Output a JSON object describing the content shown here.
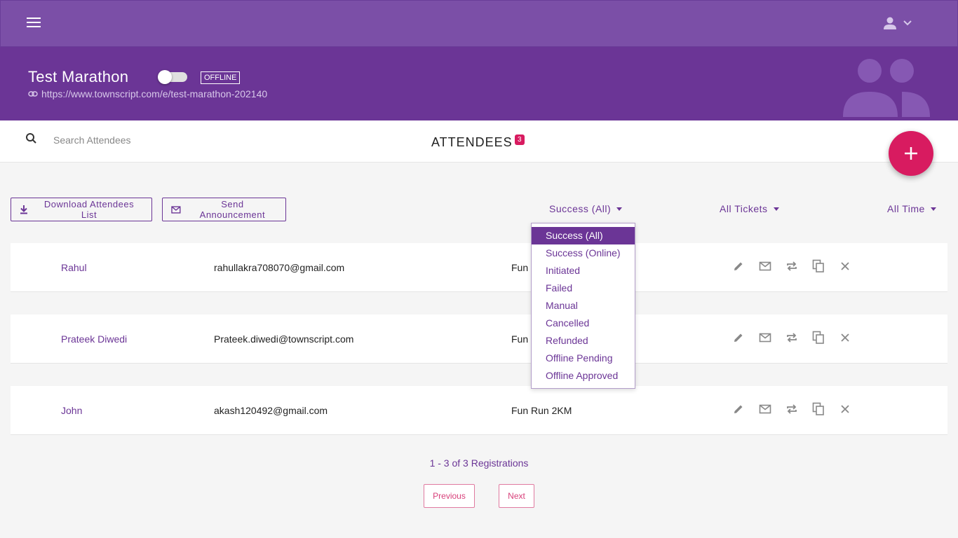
{
  "event": {
    "title": "Test Marathon",
    "status_badge": "OFFLINE",
    "url": "https://www.townscript.com/e/test-marathon-202140"
  },
  "search": {
    "placeholder": "Search Attendees"
  },
  "section": {
    "title": "ATTENDEES",
    "count": "3"
  },
  "actions": {
    "download_label": "Download Attendees List",
    "announce_label": "Send Announcement"
  },
  "filters": {
    "status": "Success (All)",
    "tickets": "All Tickets",
    "time": "All Time",
    "status_options": [
      "Success (All)",
      "Success (Online)",
      "Initiated",
      "Failed",
      "Manual",
      "Cancelled",
      "Refunded",
      "Offline Pending",
      "Offline Approved"
    ]
  },
  "attendees": [
    {
      "name": "Rahul",
      "email": "rahullakra708070@gmail.com",
      "ticket": "Fun"
    },
    {
      "name": "Prateek Diwedi",
      "email": "Prateek.diwedi@townscript.com",
      "ticket": "Fun"
    },
    {
      "name": "John",
      "email": "akash120492@gmail.com",
      "ticket": "Fun Run 2KM"
    }
  ],
  "pagination": {
    "summary": "1 - 3 of 3 Registrations",
    "previous_label": "Previous",
    "next_label": "Next"
  },
  "colors": {
    "topbar": "#7b4fa7",
    "header": "#6b3596",
    "accent": "#d81b60"
  },
  "icons": [
    "menu-icon",
    "user-icon",
    "chevron-down-icon",
    "link-icon",
    "search-icon",
    "plus-icon",
    "download-icon",
    "mail-icon",
    "edit-icon",
    "transfer-icon",
    "copy-icon",
    "close-icon"
  ]
}
